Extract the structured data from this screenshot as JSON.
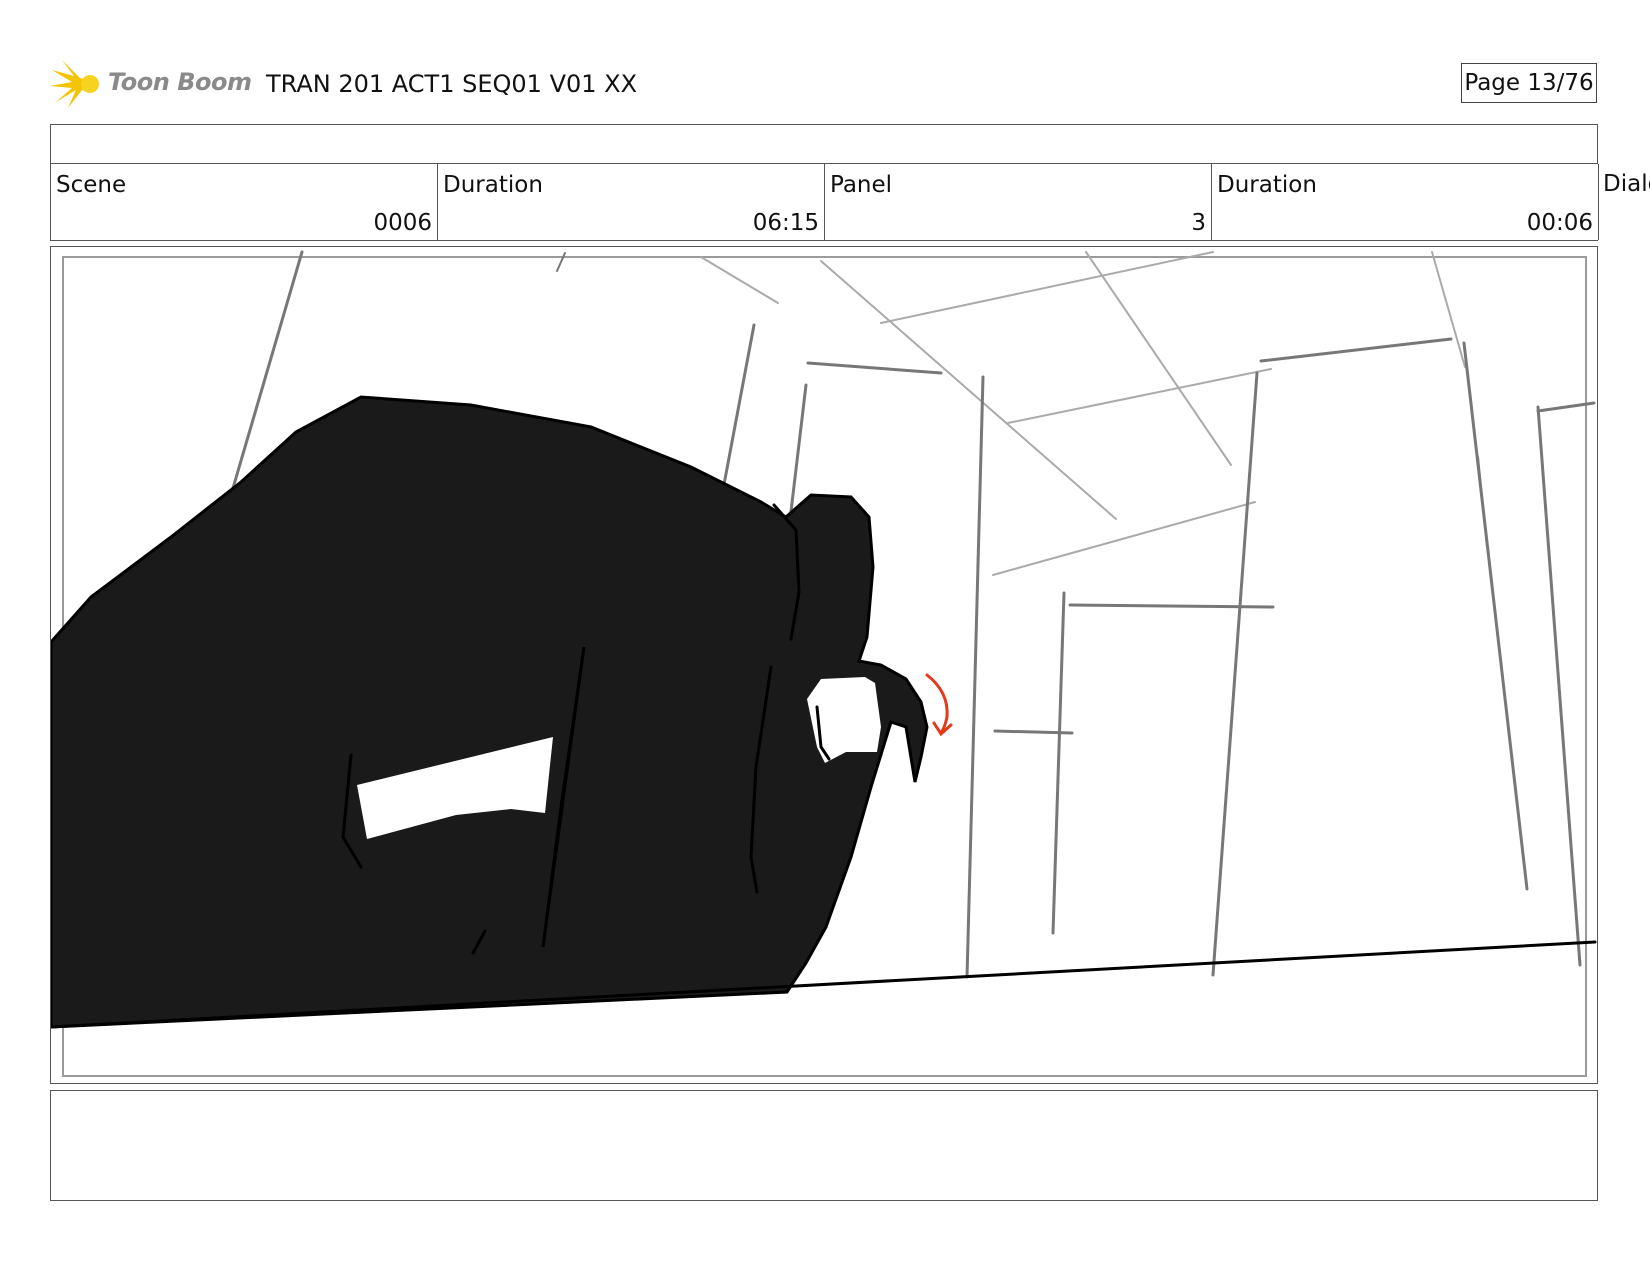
{
  "header": {
    "logo_text": "Toon Boom",
    "doc_title": "TRAN 201 ACT1 SEQ01 V01 XX",
    "page": "Page 13/76"
  },
  "info": {
    "scene_label": "Scene",
    "scene_value": "0006",
    "scene_duration_label": "Duration",
    "scene_duration_value": "06:15",
    "panel_label": "Panel",
    "panel_value": "3",
    "panel_duration_label": "Duration",
    "panel_duration_value": "00:06",
    "dialog_label": "Dialo"
  },
  "colors": {
    "logo_burst": "#f5c400",
    "ink": "#1a1a1a",
    "arrow": "#e23a1a"
  }
}
